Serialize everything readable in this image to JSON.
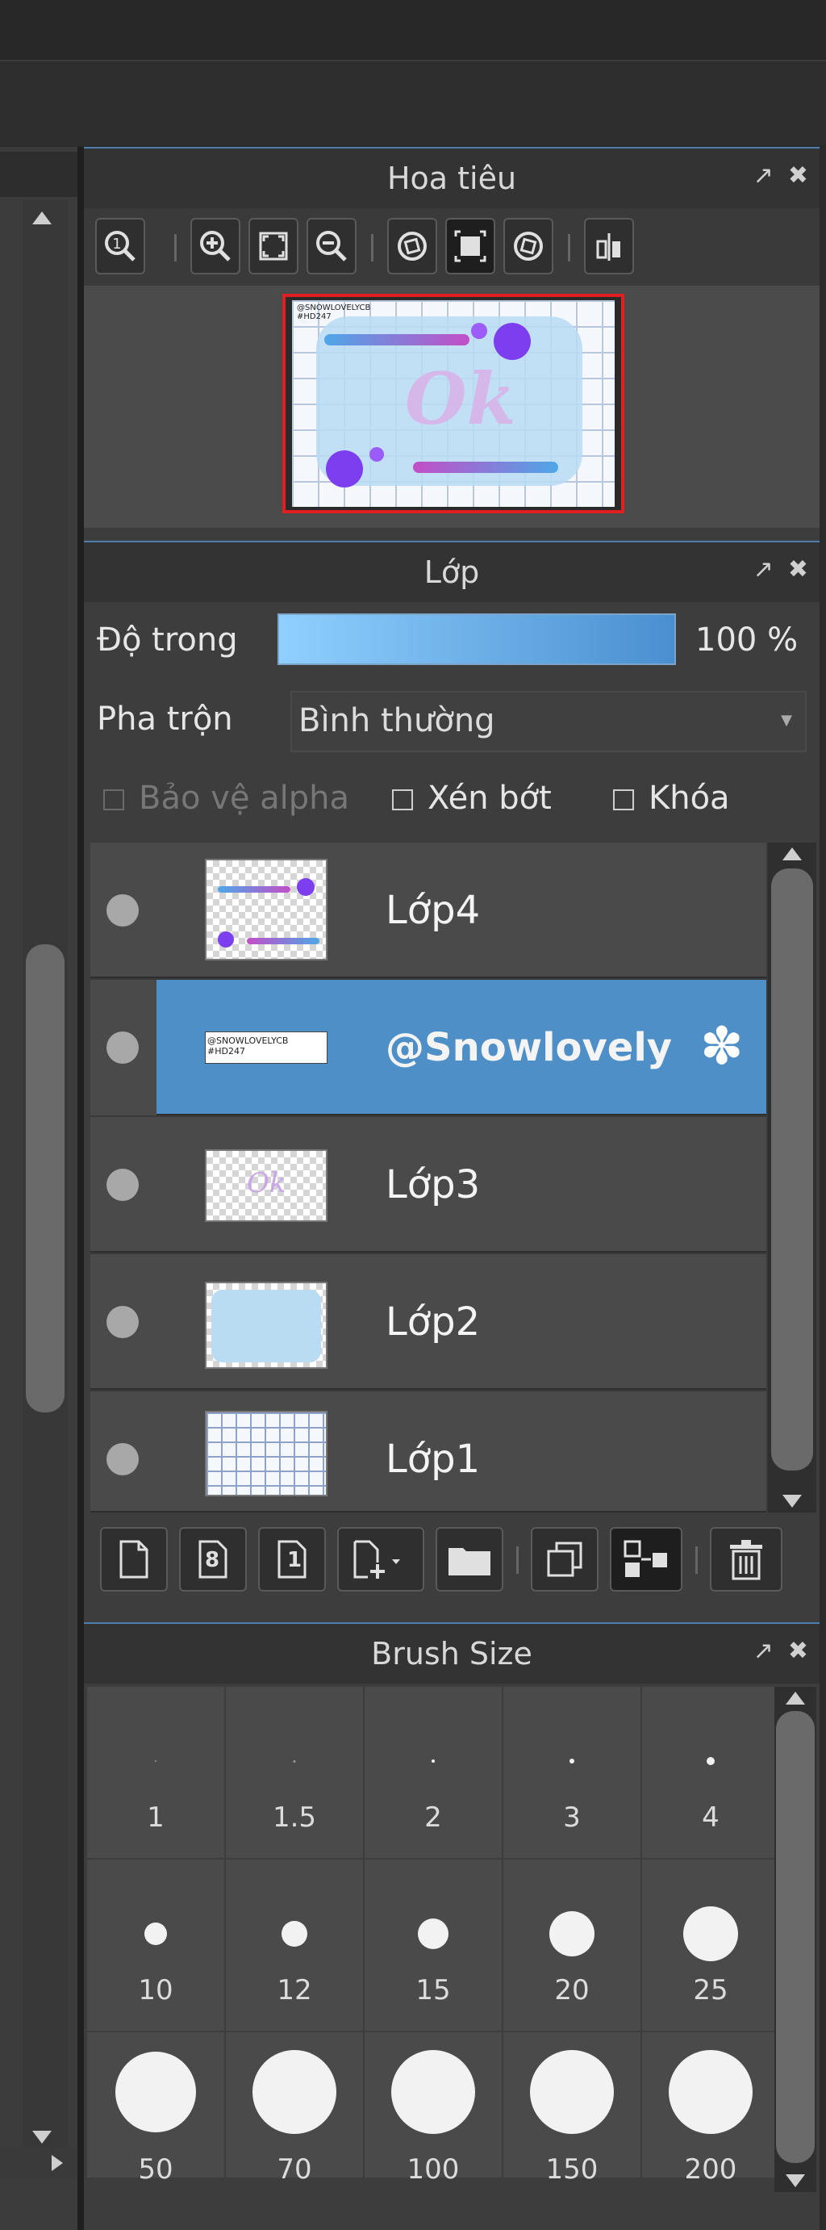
{
  "navigator": {
    "title": "Hoa tiêu",
    "tools": [
      "zoom-actual-icon",
      "zoom-in-icon",
      "fit-screen-icon",
      "zoom-out-icon",
      "rotate-left-icon",
      "fit-canvas-icon",
      "rotate-right-icon",
      "flip-icon"
    ],
    "preview": {
      "tag1": "@SNOWLOVELYCB",
      "tag2": "#HD247",
      "word": "Ok"
    }
  },
  "layers": {
    "title": "Lớp",
    "opacity_label": "Độ trong",
    "opacity_value": "100 %",
    "opacity_fraction": 1.0,
    "blend_label": "Pha trộn",
    "blend_value": "Bình thường",
    "checkboxes": {
      "protect_alpha": "Bảo vệ alpha",
      "clip": "Xén bớt",
      "lock": "Khóa"
    },
    "items": [
      {
        "name": "Lớp4",
        "selected": false,
        "thumb_text": ""
      },
      {
        "name": "@Snowlovely",
        "selected": true,
        "thumb_text": "@SNOWLOVELYCB #HD247"
      },
      {
        "name": "Lớp3",
        "selected": false,
        "thumb_text": "Ok"
      },
      {
        "name": "Lớp2",
        "selected": false,
        "thumb_text": ""
      },
      {
        "name": "Lớp1",
        "selected": false,
        "thumb_text": ""
      }
    ],
    "actions": [
      "new-layer-icon",
      "new-8bit-layer-icon",
      "new-1bit-layer-icon",
      "add-layer-menu-icon",
      "folder-icon",
      "duplicate-icon",
      "merge-icon",
      "delete-icon"
    ],
    "badge_8": "8",
    "badge_1": "1"
  },
  "brush": {
    "title": "Brush Size",
    "sizes": [
      "1",
      "1.5",
      "2",
      "3",
      "4",
      "10",
      "12",
      "15",
      "20",
      "25",
      "50",
      "70",
      "100",
      "150",
      "200"
    ]
  },
  "colors": {
    "accent": "#4d8fc6",
    "panel": "#4a4a4a",
    "header_border": "#4d7fae"
  }
}
